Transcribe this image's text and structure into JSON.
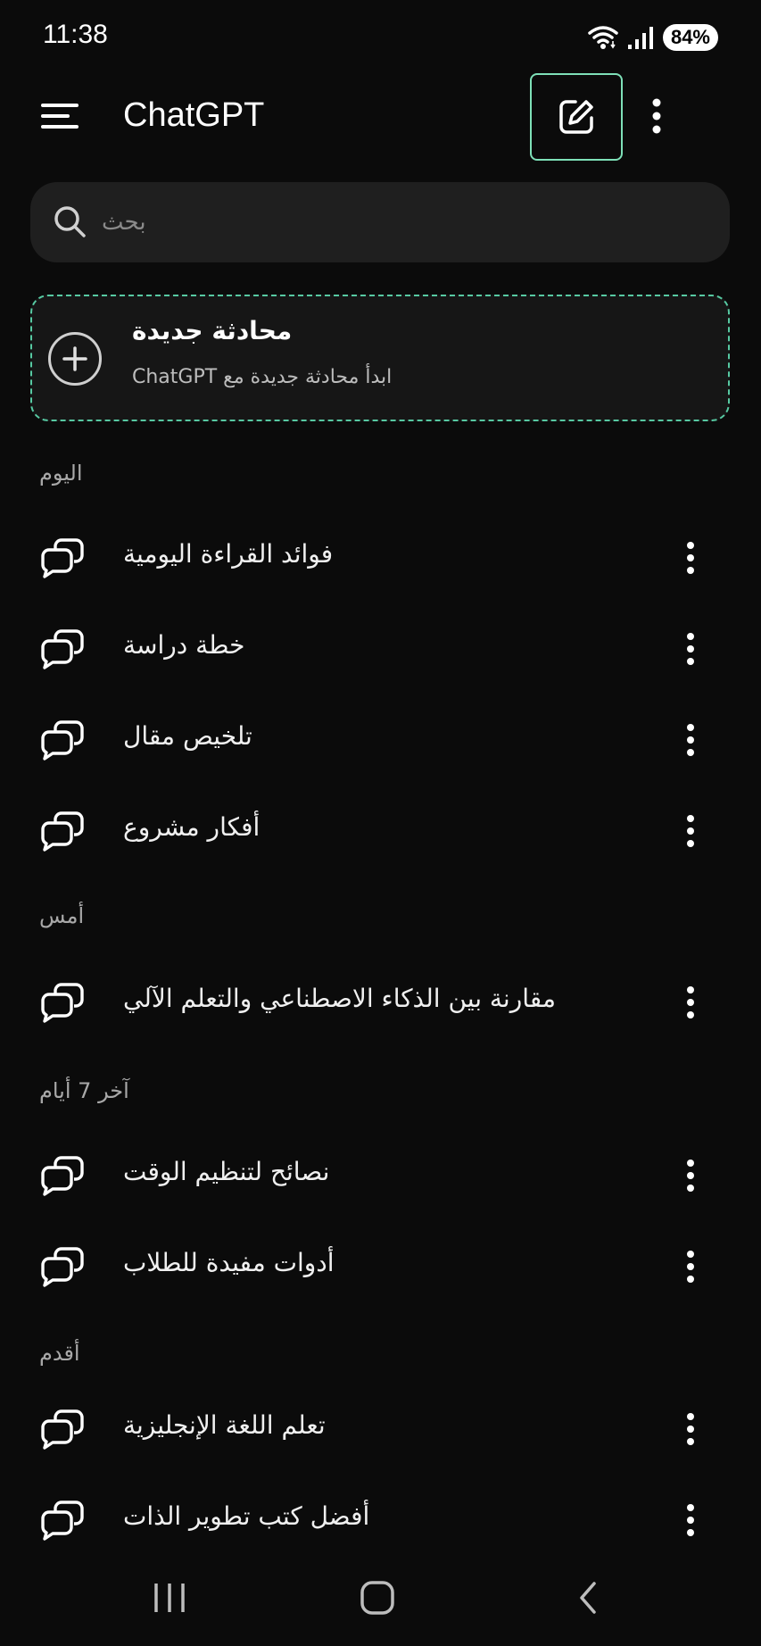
{
  "status_bar": {
    "time": "11:38",
    "battery": "84%",
    "wifi_icon": "wifi-icon",
    "signal_icon": "signal-icon"
  },
  "header": {
    "title": "ChatGPT",
    "menu_icon": "menu-icon",
    "new_chat_icon": "edit-icon",
    "more_icon": "more-vertical-icon"
  },
  "search": {
    "placeholder": "بحث",
    "value": ""
  },
  "new_conversation": {
    "title": "محادثة جديدة",
    "subtitle": "ابدأ محادثة جديدة مع ChatGPT",
    "icon": "plus-circle-icon"
  },
  "sections": {
    "today": {
      "label": "اليوم",
      "items": [
        "فوائد القراءة اليومية",
        "خطة دراسة",
        "تلخيص مقال",
        "أفكار مشروع"
      ]
    },
    "yesterday": {
      "label": "أمس",
      "items": [
        "مقارنة بين الذكاء الاصطناعي والتعلم الآلي"
      ]
    },
    "last7": {
      "label": "آخر 7 أيام",
      "items": [
        "نصائح لتنظيم الوقت",
        "أدوات مفيدة للطلاب"
      ]
    },
    "older": {
      "label": "أقدم",
      "items": [
        "تعلم اللغة الإنجليزية",
        "أفضل كتب تطوير الذات"
      ]
    }
  },
  "colors": {
    "background": "#0b0b0b",
    "accent": "#7ee0b8",
    "card_border": "#57c9a2",
    "search_bg": "#1f1f1f"
  },
  "nav_bar": {
    "recents_icon": "recents-icon",
    "home_icon": "home-icon",
    "back_icon": "back-icon"
  }
}
